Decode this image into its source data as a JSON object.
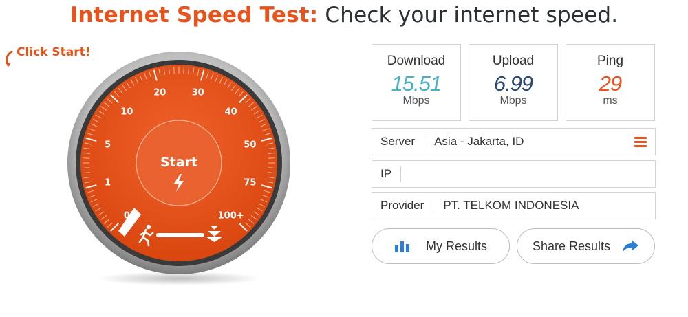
{
  "header": {
    "title_accent": "Internet Speed Test:",
    "title_rest": " Check your internet speed."
  },
  "hint": {
    "click_start": "Click Start!"
  },
  "gauge": {
    "start_label": "Start",
    "scale_labels": [
      "0",
      "1",
      "5",
      "10",
      "20",
      "30",
      "40",
      "50",
      "75",
      "100+"
    ],
    "colors": {
      "face": "#e8531c",
      "bezel": "#3a3a3a",
      "tick": "#ffffff"
    }
  },
  "stats": {
    "download": {
      "label": "Download",
      "value": "15.51",
      "unit": "Mbps",
      "color": "#45b3c4"
    },
    "upload": {
      "label": "Upload",
      "value": "6.99",
      "unit": "Mbps",
      "color": "#2a4a73"
    },
    "ping": {
      "label": "Ping",
      "value": "29",
      "unit": "ms",
      "color": "#e8531c"
    }
  },
  "info": {
    "server": {
      "label": "Server",
      "value": "Asia - Jakarta, ID"
    },
    "ip": {
      "label": "IP",
      "value": ""
    },
    "provider": {
      "label": "Provider",
      "value": "PT. TELKOM INDONESIA"
    }
  },
  "buttons": {
    "my_results": {
      "label": "My Results",
      "icon": "bar-chart-icon"
    },
    "share_results": {
      "label": "Share Results",
      "icon": "share-arrow-icon"
    }
  },
  "accent_color": "#e8531c"
}
